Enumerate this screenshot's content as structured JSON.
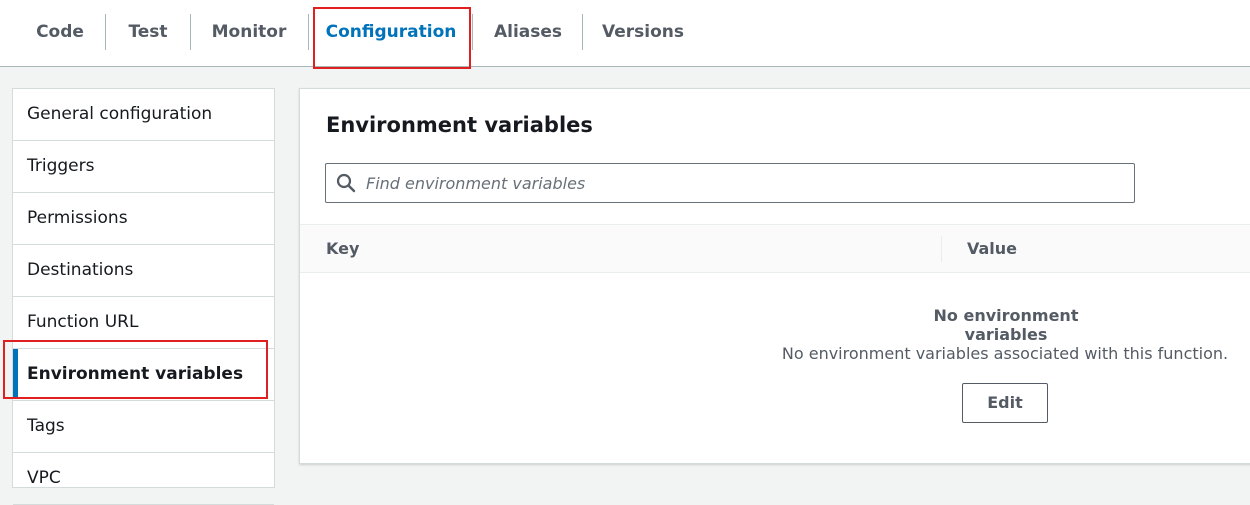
{
  "tabs": [
    {
      "label": "Code",
      "active": false
    },
    {
      "label": "Test",
      "active": false
    },
    {
      "label": "Monitor",
      "active": false
    },
    {
      "label": "Configuration",
      "active": true
    },
    {
      "label": "Aliases",
      "active": false
    },
    {
      "label": "Versions",
      "active": false
    }
  ],
  "sidebar": {
    "items": [
      {
        "label": "General configuration"
      },
      {
        "label": "Triggers"
      },
      {
        "label": "Permissions"
      },
      {
        "label": "Destinations"
      },
      {
        "label": "Function URL"
      },
      {
        "label": "Environment variables",
        "active": true
      },
      {
        "label": "Tags"
      },
      {
        "label": "VPC"
      }
    ]
  },
  "main": {
    "title": "Environment variables",
    "search": {
      "placeholder": "Find environment variables",
      "value": "",
      "icon": "search-icon"
    },
    "table": {
      "columns": [
        "Key",
        "Value"
      ]
    },
    "empty_state": {
      "title": "No environment variables",
      "description": "No environment variables associated with this function.",
      "edit_label": "Edit"
    }
  },
  "colors": {
    "accent": "#0073bb",
    "highlight": "#e02020",
    "text": "#16191f",
    "muted": "#545b64",
    "background": "#f2f3f3"
  }
}
